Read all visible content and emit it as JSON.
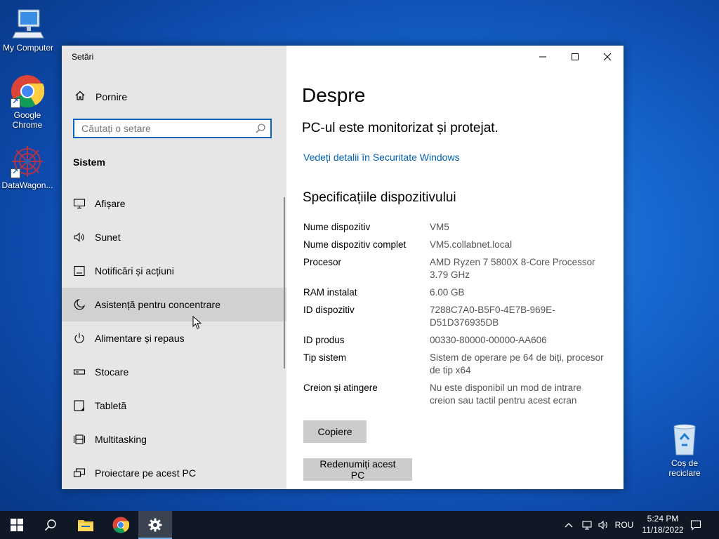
{
  "desktop": {
    "icons": [
      {
        "label": "My Computer"
      },
      {
        "label": "Google Chrome"
      },
      {
        "label": "DataWagon..."
      },
      {
        "label": "Coș de reciclare"
      }
    ]
  },
  "window": {
    "title": "Setări",
    "nav": {
      "home_label": "Pornire",
      "search_placeholder": "Căutați o setare",
      "section_label": "Sistem",
      "items": [
        {
          "label": "Afișare",
          "icon": "display-icon"
        },
        {
          "label": "Sunet",
          "icon": "speaker-icon"
        },
        {
          "label": "Notificări și acțiuni",
          "icon": "notification-icon"
        },
        {
          "label": "Asistență pentru concentrare",
          "icon": "moon-icon"
        },
        {
          "label": "Alimentare și repaus",
          "icon": "power-icon"
        },
        {
          "label": "Stocare",
          "icon": "storage-icon"
        },
        {
          "label": "Tabletă",
          "icon": "tablet-icon"
        },
        {
          "label": "Multitasking",
          "icon": "multitasking-icon"
        },
        {
          "label": "Proiectare pe acest PC",
          "icon": "projection-icon"
        }
      ]
    },
    "content": {
      "title": "Despre",
      "security_status": "PC-ul este monitorizat și protejat.",
      "security_link": "Vedeți detalii în Securitate Windows",
      "specs_title": "Specificațiile dispozitivului",
      "specs": [
        {
          "key": "Nume dispozitiv",
          "value": "VM5"
        },
        {
          "key": "Nume dispozitiv complet",
          "value": "VM5.collabnet.local"
        },
        {
          "key": "Procesor",
          "value": "AMD Ryzen 7 5800X 8-Core Processor 3.79 GHz"
        },
        {
          "key": "RAM instalat",
          "value": "6.00 GB"
        },
        {
          "key": "ID dispozitiv",
          "value": "7288C7A0-B5F0-4E7B-969E-D51D376935DB"
        },
        {
          "key": "ID produs",
          "value": "00330-80000-00000-AA606"
        },
        {
          "key": "Tip sistem",
          "value": "Sistem de operare pe 64 de biți, procesor de tip x64"
        },
        {
          "key": "Creion și atingere",
          "value": "Nu este disponibil un mod de intrare creion sau tactil pentru acest ecran"
        }
      ],
      "copy_button": "Copiere",
      "rename_button": "Redenumiți acest PC"
    }
  },
  "taskbar": {
    "language": "ROU",
    "time": "5:24 PM",
    "date": "11/18/2022"
  },
  "colors": {
    "accent": "#0a63b8",
    "link": "#0064b4",
    "nav_bg": "#e6e6e6",
    "taskbar_bg": "#101825"
  }
}
